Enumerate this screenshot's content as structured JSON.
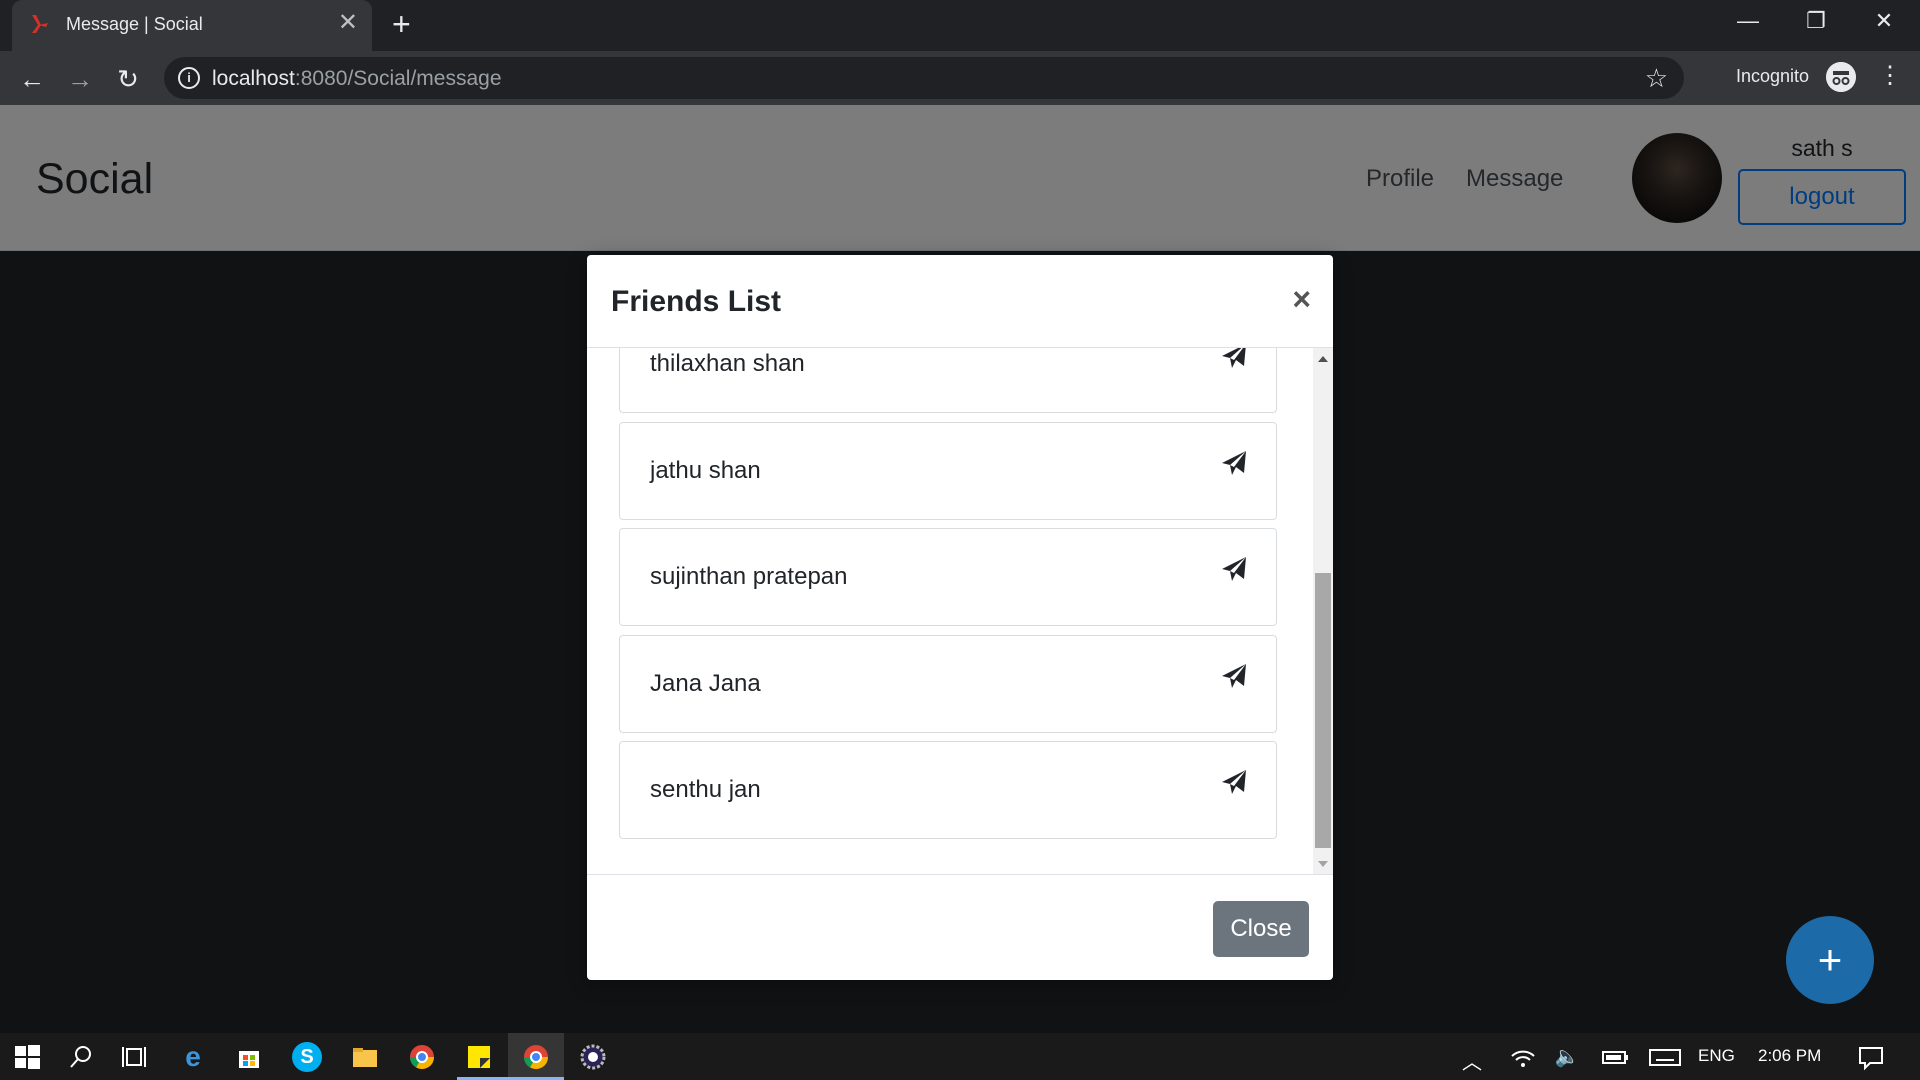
{
  "browser": {
    "tab_title": "Message | Social",
    "tab_close": "✕",
    "new_tab": "+",
    "url_host": "localhost",
    "url_rest": ":8080/Social/message",
    "incognito_label": "Incognito",
    "window_controls": {
      "minimize": "—",
      "restore": "❐",
      "close": "✕"
    }
  },
  "navbar": {
    "brand": "Social",
    "links": [
      "Profile",
      "Message"
    ],
    "username": "sath s",
    "logout_label": "logout"
  },
  "modal": {
    "title": "Friends List",
    "close_x": "×",
    "friends": [
      {
        "name": "thilaxhan shan"
      },
      {
        "name": "jathu shan"
      },
      {
        "name": "sujinthan pratepan"
      },
      {
        "name": "Jana Jana"
      },
      {
        "name": "senthu jan"
      }
    ],
    "close_label": "Close"
  },
  "fab": {
    "label": "+"
  },
  "taskbar": {
    "language": "ENG",
    "time": "2:06 PM"
  }
}
